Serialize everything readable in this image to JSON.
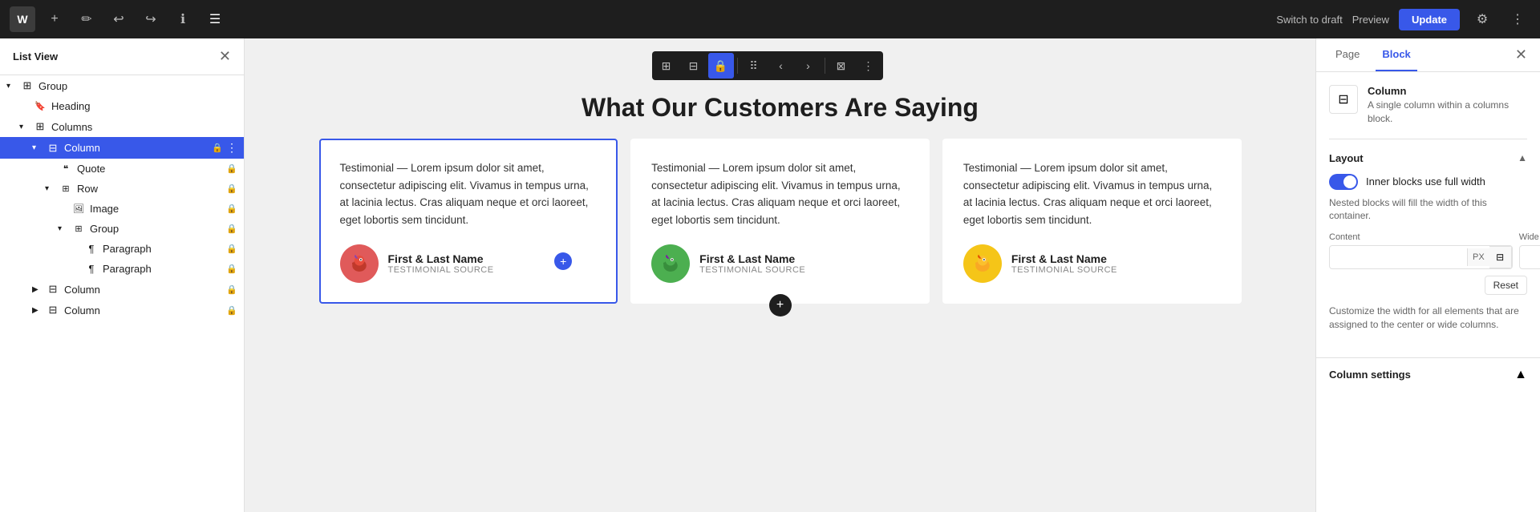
{
  "topbar": {
    "logo_text": "W",
    "buttons": {
      "add": "+",
      "edit": "✏",
      "undo": "↩",
      "redo": "↪",
      "info": "ℹ",
      "list": "☰"
    },
    "switch_draft": "Switch to draft",
    "preview": "Preview",
    "update": "Update"
  },
  "sidebar": {
    "title": "List View",
    "items": [
      {
        "label": "Group",
        "level": 0,
        "caret": "▾",
        "icon": "⊞",
        "lock": false,
        "active": false
      },
      {
        "label": "Heading",
        "level": 1,
        "caret": "",
        "icon": "🔖",
        "lock": false,
        "active": false
      },
      {
        "label": "Columns",
        "level": 1,
        "caret": "▾",
        "icon": "⊞",
        "lock": false,
        "active": false
      },
      {
        "label": "Column",
        "level": 2,
        "caret": "▾",
        "icon": "⊟",
        "lock": true,
        "active": true
      },
      {
        "label": "Quote",
        "level": 3,
        "caret": "",
        "icon": "❝",
        "lock": true,
        "active": false
      },
      {
        "label": "Row",
        "level": 3,
        "caret": "▾",
        "icon": "⊞",
        "lock": true,
        "active": false
      },
      {
        "label": "Image",
        "level": 4,
        "caret": "",
        "icon": "🖼",
        "lock": true,
        "active": false
      },
      {
        "label": "Group",
        "level": 4,
        "caret": "▾",
        "icon": "⊞",
        "lock": true,
        "active": false
      },
      {
        "label": "Paragraph",
        "level": 5,
        "caret": "",
        "icon": "¶",
        "lock": true,
        "active": false
      },
      {
        "label": "Paragraph",
        "level": 5,
        "caret": "",
        "icon": "¶",
        "lock": true,
        "active": false
      },
      {
        "label": "Column",
        "level": 2,
        "caret": "",
        "icon": "⊟",
        "lock": true,
        "active": false
      },
      {
        "label": "Column",
        "level": 2,
        "caret": "",
        "icon": "⊟",
        "lock": true,
        "active": false
      }
    ]
  },
  "page": {
    "heading": "What Our Customers Are Saying",
    "testimonials": [
      {
        "text": "Testimonial — Lorem ipsum dolor sit amet, consectetur adipiscing elit. Vivamus in tempus urna, at lacinia lectus. Cras aliquam neque et orci laoreet, eget lobortis sem tincidunt.",
        "author_name": "First & Last Name",
        "author_source": "TESTIMONIAL SOURCE",
        "avatar_color": "#e05a5a"
      },
      {
        "text": "Testimonial — Lorem ipsum dolor sit amet, consectetur adipiscing elit. Vivamus in tempus urna, at lacinia lectus. Cras aliquam neque et orci laoreet, eget lobortis sem tincidunt.",
        "author_name": "First & Last Name",
        "author_source": "TESTIMONIAL SOURCE",
        "avatar_color": "#4caf50"
      },
      {
        "text": "Testimonial — Lorem ipsum dolor sit amet, consectetur adipiscing elit. Vivamus in tempus urna, at lacinia lectus. Cras aliquam neque et orci laoreet, eget lobortis sem tincidunt.",
        "author_name": "First & Last Name",
        "author_source": "TESTIMONIAL SOURCE",
        "avatar_color": "#f5c518"
      }
    ]
  },
  "right_panel": {
    "tabs": [
      "Page",
      "Block"
    ],
    "active_tab": "Block",
    "block": {
      "icon": "⊟",
      "title": "Column",
      "description": "A single column within a columns block."
    },
    "layout": {
      "title": "Layout",
      "toggle_label": "Inner blocks use full width",
      "toggle_desc": "Nested blocks will fill the width of this container.",
      "content_label": "Content",
      "wide_label": "Wide",
      "content_placeholder": "",
      "wide_placeholder": "",
      "unit": "PX",
      "reset_label": "Reset",
      "customize_desc": "Customize the width for all elements that are assigned to the center or wide columns."
    },
    "column_settings": {
      "title": "Column settings"
    }
  }
}
